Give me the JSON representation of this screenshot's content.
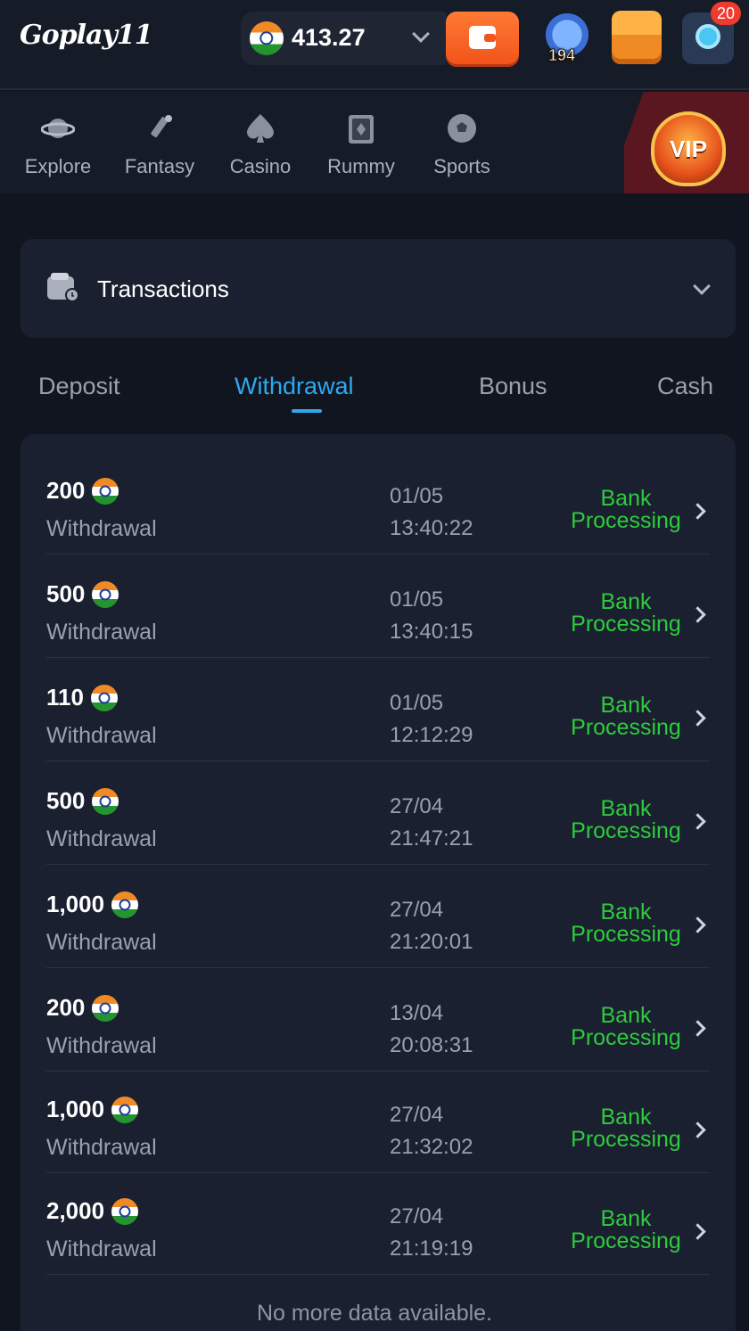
{
  "header": {
    "logo": "Goplay11",
    "balance": "413.27",
    "jar_count": "194",
    "notification_count": "20"
  },
  "nav": {
    "items": [
      {
        "label": "Explore",
        "icon": "planet-icon"
      },
      {
        "label": "Fantasy",
        "icon": "cricket-bat-icon"
      },
      {
        "label": "Casino",
        "icon": "spade-icon"
      },
      {
        "label": "Rummy",
        "icon": "cards-icon"
      },
      {
        "label": "Sports",
        "icon": "football-icon"
      }
    ],
    "vip_label": "VIP"
  },
  "transactions": {
    "title": "Transactions"
  },
  "tabs": [
    {
      "label": "Deposit",
      "active": false
    },
    {
      "label": "Withdrawal",
      "active": true
    },
    {
      "label": "Bonus",
      "active": false
    },
    {
      "label": "Cash",
      "active": false
    }
  ],
  "rows": [
    {
      "amount": "200",
      "type": "Withdrawal",
      "date": "01/05",
      "time": "13:40:22",
      "status_line1": "Bank",
      "status_line2": "Processing"
    },
    {
      "amount": "500",
      "type": "Withdrawal",
      "date": "01/05",
      "time": "13:40:15",
      "status_line1": "Bank",
      "status_line2": "Processing"
    },
    {
      "amount": "110",
      "type": "Withdrawal",
      "date": "01/05",
      "time": "12:12:29",
      "status_line1": "Bank",
      "status_line2": "Processing"
    },
    {
      "amount": "500",
      "type": "Withdrawal",
      "date": "27/04",
      "time": "21:47:21",
      "status_line1": "Bank",
      "status_line2": "Processing"
    },
    {
      "amount": "1,000",
      "type": "Withdrawal",
      "date": "27/04",
      "time": "21:20:01",
      "status_line1": "Bank",
      "status_line2": "Processing"
    },
    {
      "amount": "200",
      "type": "Withdrawal",
      "date": "13/04",
      "time": "20:08:31",
      "status_line1": "Bank",
      "status_line2": "Processing"
    },
    {
      "amount": "1,000",
      "type": "Withdrawal",
      "date": "27/04",
      "time": "21:32:02",
      "status_line1": "Bank",
      "status_line2": "Processing"
    },
    {
      "amount": "2,000",
      "type": "Withdrawal",
      "date": "27/04",
      "time": "21:19:19",
      "status_line1": "Bank",
      "status_line2": "Processing"
    }
  ],
  "footer": {
    "no_more": "No more data available."
  },
  "colors": {
    "background": "#11151f",
    "card": "#1a2030",
    "accent": "#2ea9f0",
    "status_green": "#2ecb3d",
    "wallet_orange": "#f2541b"
  }
}
